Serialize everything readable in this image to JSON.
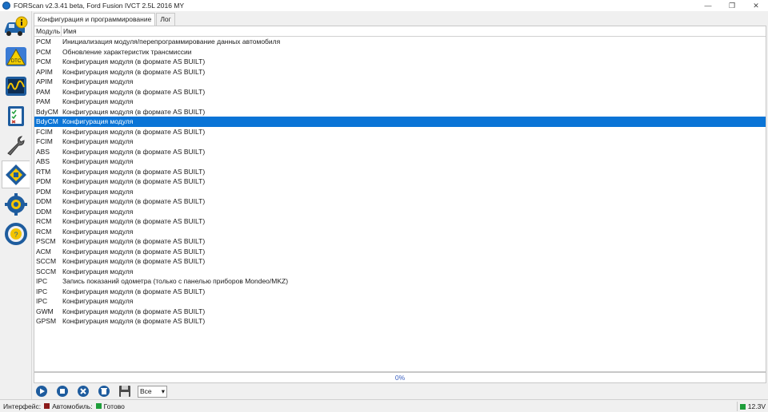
{
  "window": {
    "title": "FORScan v2.3.41 beta, Ford Fusion IVCT 2.5L 2016 MY",
    "minimize": "—",
    "maximize": "❐",
    "close": "✕"
  },
  "sidebar": {
    "items": [
      {
        "name": "vehicle-info",
        "icon": "car-info-icon"
      },
      {
        "name": "dtc",
        "icon": "dtc-icon"
      },
      {
        "name": "oscilloscope",
        "icon": "oscilloscope-icon"
      },
      {
        "name": "tests",
        "icon": "checklist-icon"
      },
      {
        "name": "service",
        "icon": "wrench-icon"
      },
      {
        "name": "config-programming",
        "icon": "chip-config-icon",
        "active": true
      },
      {
        "name": "settings",
        "icon": "gear-icon"
      },
      {
        "name": "help",
        "icon": "help-wheel-icon"
      }
    ]
  },
  "tabs": [
    {
      "label": "Конфигурация и программирование",
      "active": true
    },
    {
      "label": "Лог",
      "active": false
    }
  ],
  "table": {
    "headers": [
      "Модуль",
      "Имя"
    ],
    "rows": [
      {
        "module": "PCM",
        "name": "Инициализация модуля/перепрограммирование данных автомобиля"
      },
      {
        "module": "PCM",
        "name": "Обновление характеристик трансмиссии"
      },
      {
        "module": "PCM",
        "name": "Конфигурация модуля (в формате AS BUILT)"
      },
      {
        "module": "APIM",
        "name": "Конфигурация модуля (в формате AS BUILT)"
      },
      {
        "module": "APIM",
        "name": "Конфигурация модуля"
      },
      {
        "module": "PAM",
        "name": "Конфигурация модуля (в формате AS BUILT)"
      },
      {
        "module": "PAM",
        "name": "Конфигурация модуля"
      },
      {
        "module": "BdyCM",
        "name": "Конфигурация модуля (в формате AS BUILT)"
      },
      {
        "module": "BdyCM",
        "name": "Конфигурация модуля",
        "selected": true
      },
      {
        "module": "FCIM",
        "name": "Конфигурация модуля (в формате AS BUILT)"
      },
      {
        "module": "FCIM",
        "name": "Конфигурация модуля"
      },
      {
        "module": "ABS",
        "name": "Конфигурация модуля (в формате AS BUILT)"
      },
      {
        "module": "ABS",
        "name": "Конфигурация модуля"
      },
      {
        "module": "RTM",
        "name": "Конфигурация модуля (в формате AS BUILT)"
      },
      {
        "module": "PDM",
        "name": "Конфигурация модуля (в формате AS BUILT)"
      },
      {
        "module": "PDM",
        "name": "Конфигурация модуля"
      },
      {
        "module": "DDM",
        "name": "Конфигурация модуля (в формате AS BUILT)"
      },
      {
        "module": "DDM",
        "name": "Конфигурация модуля"
      },
      {
        "module": "RCM",
        "name": "Конфигурация модуля (в формате AS BUILT)"
      },
      {
        "module": "RCM",
        "name": "Конфигурация модуля"
      },
      {
        "module": "PSCM",
        "name": "Конфигурация модуля (в формате AS BUILT)"
      },
      {
        "module": "ACM",
        "name": "Конфигурация модуля (в формате AS BUILT)"
      },
      {
        "module": "SCCM",
        "name": "Конфигурация модуля (в формате AS BUILT)"
      },
      {
        "module": "SCCM",
        "name": "Конфигурация модуля"
      },
      {
        "module": "IPC",
        "name": "Запись показаний одометра (только с панелью приборов Mondeo/MKZ)"
      },
      {
        "module": "IPC",
        "name": "Конфигурация модуля (в формате AS BUILT)"
      },
      {
        "module": "IPC",
        "name": "Конфигурация модуля"
      },
      {
        "module": "GWM",
        "name": "Конфигурация модуля (в формате AS BUILT)"
      },
      {
        "module": "GPSM",
        "name": "Конфигурация модуля (в формате AS BUILT)"
      }
    ]
  },
  "progress": {
    "label": "0%",
    "value": 0
  },
  "toolbar": {
    "buttons": [
      "play-icon",
      "stop-icon",
      "cancel-icon",
      "delete-icon",
      "save-icon"
    ],
    "filter": {
      "selected": "Все",
      "arrow": "▾"
    }
  },
  "status": {
    "interface_label": "Интерфейс:",
    "vehicle_label": "Автомобиль:",
    "state": "Готово",
    "voltage": "12.3V",
    "colors": {
      "interface": "#8b1a1a",
      "vehicle": "#1e9e3a",
      "voltage": "#1e9e3a"
    }
  },
  "colors": {
    "selection": "#0a74d6",
    "progress_text": "#3a5fc0"
  }
}
